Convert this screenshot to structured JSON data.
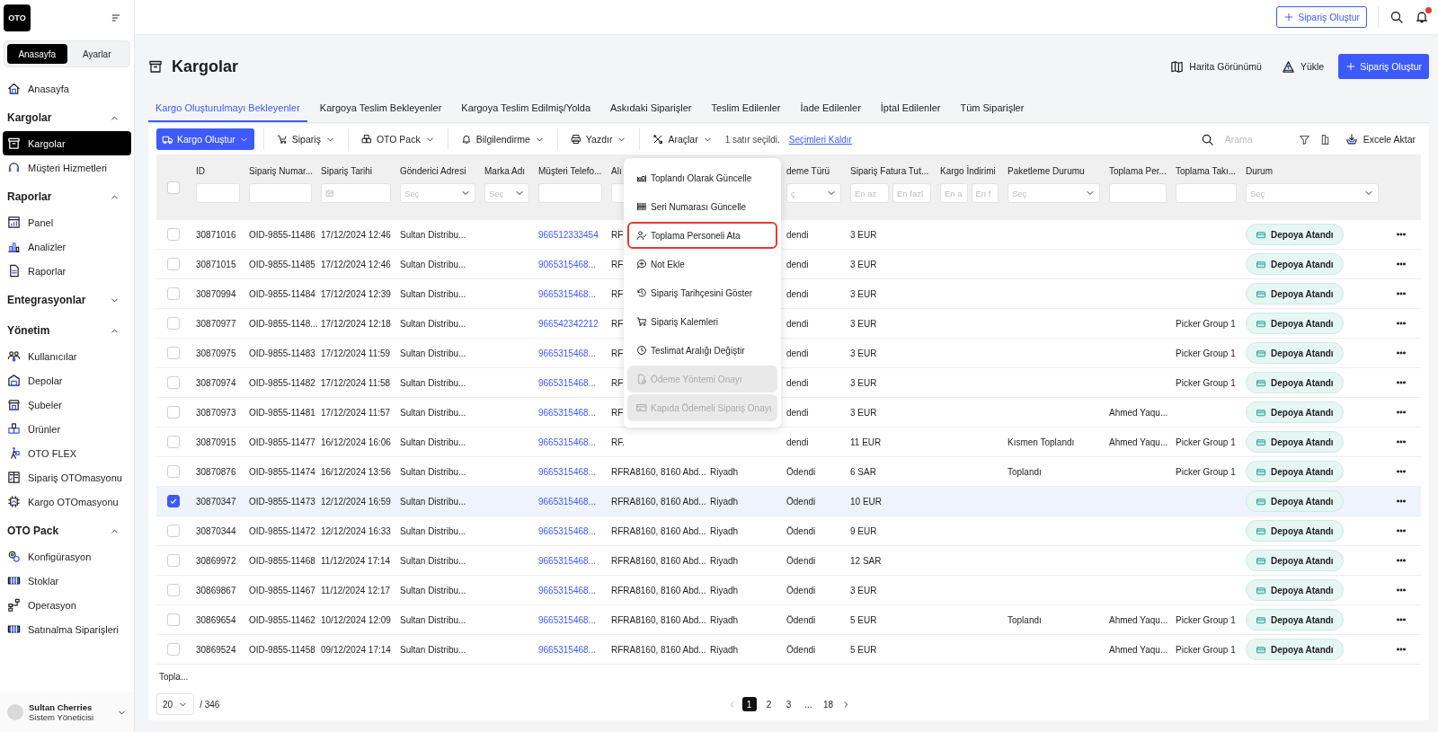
{
  "sidebar": {
    "logo": "OTO",
    "mode_tabs": [
      {
        "label": "Anasayfa",
        "selected": true
      },
      {
        "label": "Ayarlar",
        "selected": false
      }
    ],
    "top_items": [
      {
        "label": "Anasayfa",
        "selected": false
      }
    ],
    "sections": [
      {
        "title": "Kargolar",
        "expanded": true,
        "items": [
          {
            "label": "Kargolar",
            "selected": true
          },
          {
            "label": "Müşteri Hizmetleri",
            "selected": false
          }
        ]
      },
      {
        "title": "Raporlar",
        "expanded": true,
        "items": [
          {
            "label": "Panel",
            "selected": false
          },
          {
            "label": "Analizler",
            "selected": false
          },
          {
            "label": "Raporlar",
            "selected": false
          }
        ]
      },
      {
        "title": "Entegrasyonlar",
        "expanded": false
      },
      {
        "title": "Yönetim",
        "expanded": true,
        "items": [
          {
            "label": "Kullanıcılar",
            "selected": false
          },
          {
            "label": "Depolar",
            "selected": false
          },
          {
            "label": "Şubeler",
            "selected": false
          },
          {
            "label": "Ürünler",
            "selected": false
          },
          {
            "label": "OTO FLEX",
            "selected": false
          },
          {
            "label": "Sipariş OTOmasyonu",
            "selected": false
          },
          {
            "label": "Kargo OTOmasyonu",
            "selected": false
          }
        ]
      },
      {
        "title": "OTO Pack",
        "expanded": true,
        "items": [
          {
            "label": "Konfigürasyon",
            "selected": false
          },
          {
            "label": "Stoklar",
            "selected": false
          },
          {
            "label": "Operasyon",
            "selected": false
          },
          {
            "label": "Satınalma Siparişleri",
            "selected": false
          }
        ]
      }
    ],
    "user": {
      "name": "Sultan Cherries",
      "role": "Sistem Yöneticisi"
    }
  },
  "topbar": {
    "create_button": "Sipariş Oluştur"
  },
  "page": {
    "title": "Kargolar",
    "actions": [
      {
        "kind": "link",
        "label": "Harita Görünümü"
      },
      {
        "kind": "link",
        "label": "Yükle"
      },
      {
        "kind": "primary",
        "label": "Sipariş Oluştur"
      }
    ]
  },
  "tabs": [
    {
      "label": "Kargo Oluşturulmayı Bekleyenler",
      "selected": true
    },
    {
      "label": "Kargoya Teslim Bekleyenler",
      "selected": false
    },
    {
      "label": "Kargoya Teslim Edilmiş/Yolda",
      "selected": false
    },
    {
      "label": "Askıdaki Siparişler",
      "selected": false
    },
    {
      "label": "Teslim Edilenler",
      "selected": false
    },
    {
      "label": "İade Edilenler",
      "selected": false
    },
    {
      "label": "İptal Edilenler",
      "selected": false
    },
    {
      "label": "Tüm Siparişler",
      "selected": false
    }
  ],
  "toolbar": {
    "primary": "Kargo Oluştur",
    "dropdowns": [
      "Sipariş",
      "OTO Pack",
      "Bilgilendirme",
      "Yazdır",
      "Araçlar"
    ],
    "selection_info": "1 satır seçildi.",
    "clear_link": "Seçimleri Kaldır",
    "search": {
      "placeholder": "Arama"
    },
    "export": "Excele Aktar"
  },
  "menu": {
    "items": [
      {
        "label": "Toplandı Olarak Güncelle",
        "disabled": false,
        "highlighted": false
      },
      {
        "label": "Seri Numarası Güncelle",
        "disabled": false,
        "highlighted": false
      },
      {
        "label": "Toplama Personeli Ata",
        "disabled": false,
        "highlighted": true
      },
      {
        "label": "Not Ekle",
        "disabled": false,
        "highlighted": false
      },
      {
        "label": "Sipariş Tarihçesini Göster",
        "disabled": false,
        "highlighted": false
      },
      {
        "label": "Sipariş Kalemleri",
        "disabled": false,
        "highlighted": false
      },
      {
        "label": "Teslimat Aralığı Değiştir",
        "disabled": false,
        "highlighted": false
      },
      {
        "label": "Ödeme Yöntemi Onayı",
        "disabled": true,
        "highlighted": false
      },
      {
        "label": "Kapıda Ödemeli Sipariş Onayı",
        "disabled": true,
        "highlighted": false
      }
    ]
  },
  "table": {
    "select_all": {
      "checked": false
    },
    "columns": [
      {
        "label": "ID",
        "filter": {
          "kind": "text"
        }
      },
      {
        "label": "Sipariş Numar...",
        "filter": {
          "kind": "text"
        }
      },
      {
        "label": "Sipariş Tarihi",
        "filter": {
          "kind": "date"
        }
      },
      {
        "label": "Gönderici Adresi",
        "filter": {
          "kind": "select",
          "placeholder": "Seç"
        }
      },
      {
        "label": "Marka Adı",
        "filter": {
          "kind": "select",
          "placeholder": "Seç"
        }
      },
      {
        "label": "Müşteri Telefo...",
        "filter": {
          "kind": "text"
        }
      },
      {
        "label": "Alı",
        "filter": {
          "kind": "text"
        }
      },
      {
        "filter": {
          "kind": "none"
        }
      },
      {
        "label": "deme Türü",
        "filter": {
          "kind": "select",
          "placeholder": "ç"
        }
      },
      {
        "label": "Sipariş Fatura Tut...",
        "filter": {
          "kind": "range",
          "placeholders": [
            "En az",
            "En fazl"
          ]
        }
      },
      {
        "label": "Kargo İndirimi",
        "filter": {
          "kind": "range",
          "placeholders": [
            "En a",
            "En f"
          ]
        }
      },
      {
        "label": "Paketleme Durumu",
        "filter": {
          "kind": "select",
          "placeholder": "Seç"
        }
      },
      {
        "label": "Toplama Per...",
        "filter": {
          "kind": "text"
        }
      },
      {
        "label": "Toplama Takı...",
        "filter": {
          "kind": "text"
        }
      },
      {
        "label": "Durum",
        "filter": {
          "kind": "select",
          "placeholder": "Seç"
        }
      }
    ],
    "rows": [
      {
        "selected": false,
        "id": "30871016",
        "order_no": "OID-9855-11486",
        "date": "17/12/2024 12:46",
        "sender": "Sultan Distribu...",
        "phone": "966512333454",
        "recipient": "RF",
        "payment": "dendi",
        "amount": "3 EUR",
        "status": "Depoya Atandı"
      },
      {
        "selected": false,
        "id": "30871015",
        "order_no": "OID-9855-11485",
        "date": "17/12/2024 12:46",
        "sender": "Sultan Distribu...",
        "phone": "9065315468...",
        "recipient": "RF",
        "payment": "dendi",
        "amount": "3 EUR",
        "status": "Depoya Atandı"
      },
      {
        "selected": false,
        "id": "30870994",
        "order_no": "OID-9855-11484",
        "date": "17/12/2024 12:39",
        "sender": "Sultan Distribu...",
        "phone": "9665315468...",
        "recipient": "RF",
        "payment": "dendi",
        "amount": "3 EUR",
        "status": "Depoya Atandı"
      },
      {
        "selected": false,
        "id": "30870977",
        "order_no": "OID-9855-1148...",
        "date": "17/12/2024 12:18",
        "sender": "Sultan Distribu...",
        "phone": "966542342212",
        "recipient": "RF",
        "payment": "dendi",
        "amount": "3 EUR",
        "picker_group": "Picker Group 1",
        "status": "Depoya Atandı"
      },
      {
        "selected": false,
        "id": "30870975",
        "order_no": "OID-9855-11483",
        "date": "17/12/2024 11:59",
        "sender": "Sultan Distribu...",
        "phone": "9665315468...",
        "recipient": "RF",
        "payment": "dendi",
        "amount": "3 EUR",
        "picker_group": "Picker Group 1",
        "status": "Depoya Atandı"
      },
      {
        "selected": false,
        "id": "30870974",
        "order_no": "OID-9855-11482",
        "date": "17/12/2024 11:58",
        "sender": "Sultan Distribu...",
        "phone": "9665315468...",
        "recipient": "RF",
        "payment": "dendi",
        "amount": "3 EUR",
        "picker_group": "Picker Group 1",
        "status": "Depoya Atandı"
      },
      {
        "selected": false,
        "id": "30870973",
        "order_no": "OID-9855-11481",
        "date": "17/12/2024 11:57",
        "sender": "Sultan Distribu...",
        "phone": "9665315468...",
        "recipient": "RF",
        "payment": "dendi",
        "amount": "3 EUR",
        "picker": "Ahmed Yaqu...",
        "status": "Depoya Atandı"
      },
      {
        "selected": false,
        "id": "30870915",
        "order_no": "OID-9855-11477",
        "date": "16/12/2024 16:06",
        "sender": "Sultan Distribu...",
        "phone": "9665315468...",
        "recipient": "RF.",
        "payment": "dendi",
        "amount": "11 EUR",
        "packing": "Kısmen Toplandı",
        "picker": "Ahmed Yaqu...",
        "picker_group": "Picker Group 1",
        "status": "Depoya Atandı"
      },
      {
        "selected": false,
        "id": "30870876",
        "order_no": "OID-9855-11474",
        "date": "16/12/2024 13:56",
        "sender": "Sultan Distribu...",
        "phone": "9665315468...",
        "recipient": "RFRA8160, 8160 Abd...",
        "city": "Riyadh",
        "payment": "Ödendi",
        "amount": "6 SAR",
        "packing": "Toplandı",
        "picker_group": "Picker Group 1",
        "status": "Depoya Atandı"
      },
      {
        "selected": true,
        "id": "30870347",
        "order_no": "OID-9855-11473",
        "date": "12/12/2024 16:59",
        "sender": "Sultan Distribu...",
        "phone": "9665315468...",
        "recipient": "RFRA8160, 8160 Abd...",
        "city": "Riyadh",
        "payment": "Ödendi",
        "amount": "10 EUR",
        "status": "Depoya Atandı"
      },
      {
        "selected": false,
        "id": "30870344",
        "order_no": "OID-9855-11472",
        "date": "12/12/2024 16:33",
        "sender": "Sultan Distribu...",
        "phone": "9665315468...",
        "recipient": "RFRA8160, 8160 Abd...",
        "city": "Riyadh",
        "payment": "Ödendi",
        "amount": "9 EUR",
        "status": "Depoya Atandı"
      },
      {
        "selected": false,
        "id": "30869972",
        "order_no": "OID-9855-11468",
        "date": "11/12/2024 17:14",
        "sender": "Sultan Distribu...",
        "phone": "9665315468...",
        "recipient": "RFRA8160, 8160 Abd...",
        "city": "Riyadh",
        "payment": "Ödendi",
        "amount": "12 SAR",
        "status": "Depoya Atandı"
      },
      {
        "selected": false,
        "id": "30869867",
        "order_no": "OID-9855-11467",
        "date": "11/12/2024 12:17",
        "sender": "Sultan Distribu...",
        "phone": "9665315468...",
        "recipient": "RFRA8160, 8160 Abd...",
        "city": "Riyadh",
        "payment": "Ödendi",
        "amount": "3 EUR",
        "status": "Depoya Atandı"
      },
      {
        "selected": false,
        "id": "30869654",
        "order_no": "OID-9855-11462",
        "date": "10/12/2024 12:09",
        "sender": "Sultan Distribu...",
        "phone": "9665315468...",
        "recipient": "RFRA8160, 8160 Abd...",
        "city": "Riyadh",
        "payment": "Ödendi",
        "amount": "5 EUR",
        "packing": "Toplandı",
        "picker": "Ahmed Yaqu...",
        "picker_group": "Picker Group 1",
        "status": "Depoya Atandı"
      },
      {
        "selected": false,
        "id": "30869524",
        "order_no": "OID-9855-11458",
        "date": "09/12/2024 17:14",
        "sender": "Sultan Distribu...",
        "phone": "9665315468...",
        "recipient": "RFRA8160, 8160 Abd...",
        "city": "Riyadh",
        "payment": "Ödendi",
        "amount": "5 EUR",
        "picker": "Ahmed Yaqu...",
        "picker_group": "Picker Group 1",
        "status": "Depoya Atandı"
      }
    ],
    "footer_label": "Topla..."
  },
  "pagination": {
    "page_size": "20",
    "total": "/ 346",
    "pages": [
      {
        "label": "1",
        "selected": true
      },
      {
        "label": "2",
        "selected": false
      },
      {
        "label": "3",
        "selected": false
      },
      {
        "label": "...",
        "selected": false
      },
      {
        "label": "18",
        "selected": false
      }
    ]
  }
}
